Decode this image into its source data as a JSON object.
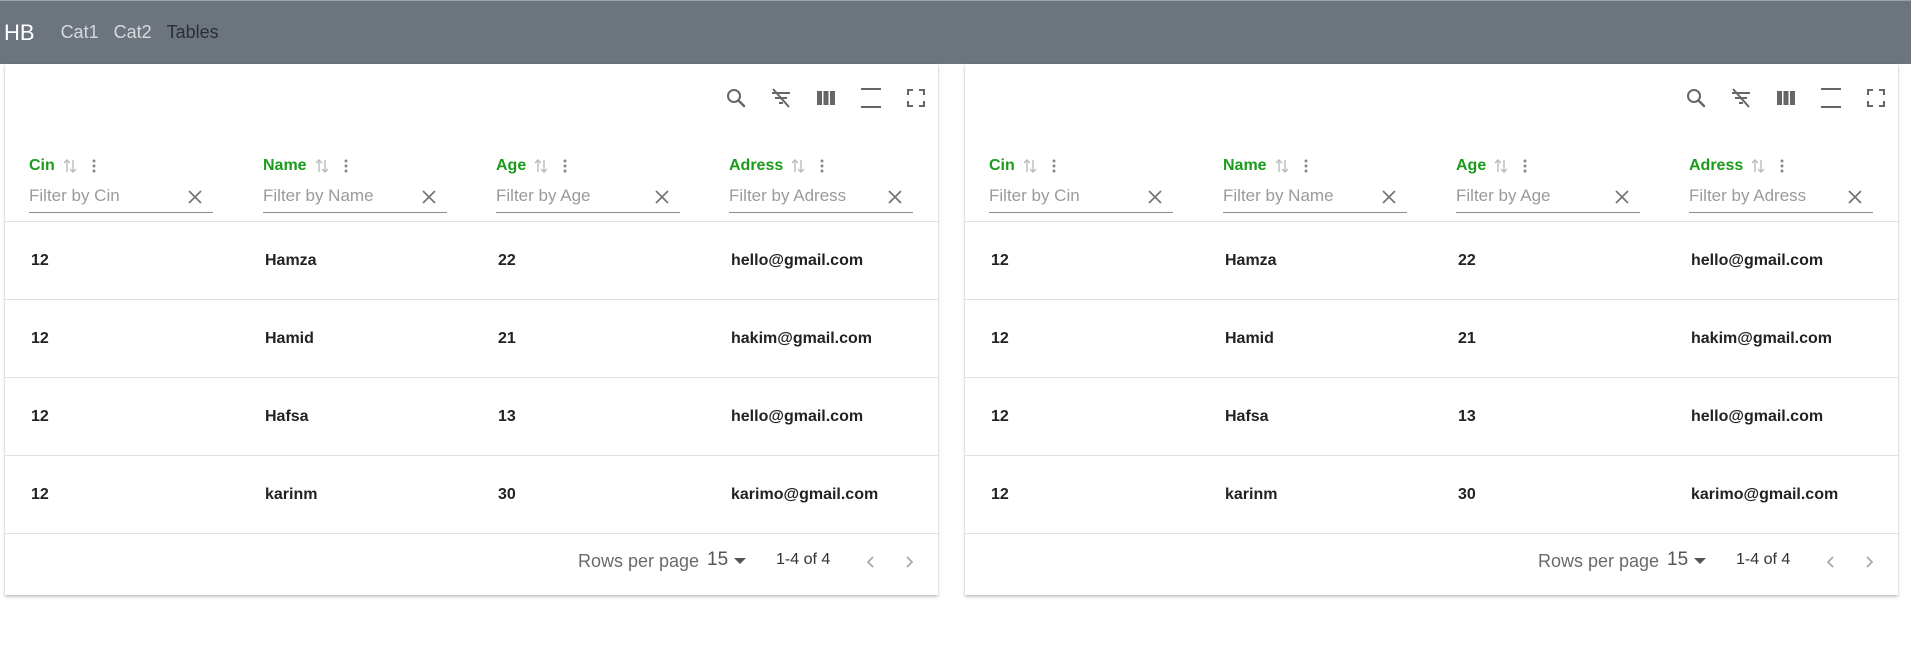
{
  "navbar": {
    "brand": "HB",
    "links": [
      {
        "label": "Cat1"
      },
      {
        "label": "Cat2"
      },
      {
        "label": "Tables"
      }
    ]
  },
  "icons": {
    "search": "search-icon",
    "filter_off": "filter-off-icon",
    "columns": "view-column-icon",
    "density": "density-icon",
    "fullscreen": "fullscreen-icon",
    "sort": "sort-arrows-icon",
    "column_menu": "more-vertical-icon",
    "clear": "close-icon",
    "prev": "chevron-left-icon",
    "next": "chevron-right-icon"
  },
  "colors": {
    "navbar_bg": "#6c757d",
    "header_text": "#1a9b1a"
  },
  "tables": [
    {
      "columns": [
        {
          "label": "Cin",
          "filter_placeholder": "Filter by Cin"
        },
        {
          "label": "Name",
          "filter_placeholder": "Filter by Name"
        },
        {
          "label": "Age",
          "filter_placeholder": "Filter by Age"
        },
        {
          "label": "Adress",
          "filter_placeholder": "Filter by Adress"
        }
      ],
      "rows": [
        [
          "12",
          "Hamza",
          "22",
          "hello@gmail.com"
        ],
        [
          "12",
          "Hamid",
          "21",
          "hakim@gmail.com"
        ],
        [
          "12",
          "Hafsa",
          "13",
          "hello@gmail.com"
        ],
        [
          "12",
          "karinm",
          "30",
          "karimo@gmail.com"
        ]
      ],
      "footer": {
        "rows_per_page_label": "Rows per page",
        "rows_per_page_value": "15",
        "page_info": "1-4 of 4"
      }
    },
    {
      "columns": [
        {
          "label": "Cin",
          "filter_placeholder": "Filter by Cin"
        },
        {
          "label": "Name",
          "filter_placeholder": "Filter by Name"
        },
        {
          "label": "Age",
          "filter_placeholder": "Filter by Age"
        },
        {
          "label": "Adress",
          "filter_placeholder": "Filter by Adress"
        }
      ],
      "rows": [
        [
          "12",
          "Hamza",
          "22",
          "hello@gmail.com"
        ],
        [
          "12",
          "Hamid",
          "21",
          "hakim@gmail.com"
        ],
        [
          "12",
          "Hafsa",
          "13",
          "hello@gmail.com"
        ],
        [
          "12",
          "karinm",
          "30",
          "karimo@gmail.com"
        ]
      ],
      "footer": {
        "rows_per_page_label": "Rows per page",
        "rows_per_page_value": "15",
        "page_info": "1-4 of 4"
      }
    }
  ]
}
